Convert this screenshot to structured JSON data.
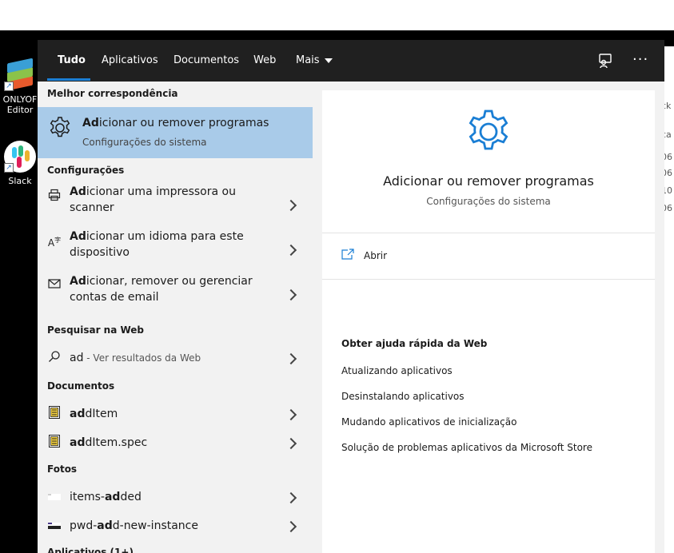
{
  "desktop": {
    "icons": [
      {
        "label_line1": "ONLYOF",
        "label_line2": "Editor"
      },
      {
        "label_line1": "Slack",
        "label_line2": ""
      }
    ],
    "bg_window_texts": [
      "ck",
      "ca",
      "06",
      "06",
      "10",
      "06"
    ]
  },
  "topbar": {
    "tabs": [
      {
        "label": "Tudo"
      },
      {
        "label": "Aplicativos"
      },
      {
        "label": "Documentos"
      },
      {
        "label": "Web"
      },
      {
        "label": "Mais"
      }
    ],
    "more_label": "···"
  },
  "left": {
    "best_match_header": "Melhor correspondência",
    "best_match": {
      "title_bold": "Ad",
      "title_rest": "icionar ou remover programas",
      "subtitle": "Configurações do sistema",
      "icon": "gear-icon"
    },
    "settings_header": "Configurações",
    "settings_items": [
      {
        "bold": "Ad",
        "rest": "icionar uma impressora ou scanner",
        "icon": "printer-icon"
      },
      {
        "bold": "Ad",
        "rest": "icionar um idioma para este dispositivo",
        "icon": "language-icon"
      },
      {
        "bold": "Ad",
        "rest": "icionar, remover ou gerenciar contas de email",
        "icon": "mail-icon"
      }
    ],
    "web_header": "Pesquisar na Web",
    "web_item": {
      "query": "ad",
      "suffix": " - Ver resultados da Web",
      "icon": "search-icon"
    },
    "docs_header": "Documentos",
    "docs_items": [
      {
        "bold": "ad",
        "rest": "dItem",
        "icon": "script-file-icon"
      },
      {
        "bold": "ad",
        "rest": "dItem.spec",
        "icon": "script-file-icon"
      }
    ],
    "photos_header": "Fotos",
    "photos_items": [
      {
        "pre": "items-",
        "bold": "ad",
        "rest": "ded",
        "icon": "image-thumbnail-icon"
      },
      {
        "pre": "pwd-",
        "bold": "ad",
        "rest": "d-new-instance",
        "icon": "image-thumbnail-icon"
      }
    ],
    "apps_header_cut": "Aplicativos (1+)"
  },
  "right": {
    "title": "Adicionar ou remover programas",
    "subtitle": "Configurações do sistema",
    "open_label": "Abrir",
    "help_header": "Obter ajuda rápida da Web",
    "help_links": [
      "Atualizando aplicativos",
      "Desinstalando aplicativos",
      "Mudando aplicativos de inicialização",
      "Solução de problemas aplicativos da Microsoft Store"
    ]
  },
  "colors": {
    "accent": "#1a7ed4",
    "selected_bg": "#a9cbe9",
    "topbar_bg": "#202020",
    "panel_bg": "#f2f2f2"
  }
}
